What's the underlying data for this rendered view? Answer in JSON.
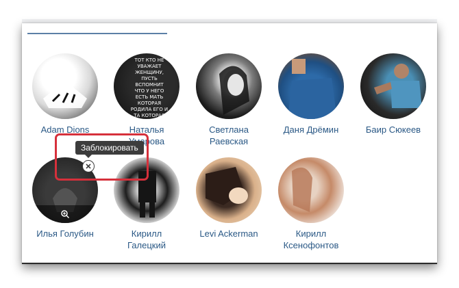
{
  "friends": [
    {
      "name_line1": "Adam Dions",
      "name_line2": ""
    },
    {
      "name_line1": "Наталья",
      "name_line2": "Умарова",
      "avatar_text": "ТОТ КТО НЕ УВАЖАЕТ ЖЕНЩИНУ, ПУСТЬ ВСПОМНИТ ЧТО У НЕГО ЕСТЬ МАТЬ КОТОРАЯ РОДИЛА ЕГО И ТА КОТОРАЯ РОДИТ ЕМУ И ТУ КОТОРАЯ РОДИТСЯ У НЕГО"
    },
    {
      "name_line1": "Светлана",
      "name_line2": "Раевская"
    },
    {
      "name_line1": "Даня Дрёмин",
      "name_line2": ""
    },
    {
      "name_line1": "Баир Сюкеев",
      "name_line2": ""
    },
    {
      "name_line1": "Илья Голубин",
      "name_line2": ""
    },
    {
      "name_line1": "Кирилл",
      "name_line2": "Галецкий"
    },
    {
      "name_line1": "Levi Ackerman",
      "name_line2": ""
    },
    {
      "name_line1": "Кирилл",
      "name_line2": "Ксенофонтов"
    }
  ],
  "tooltip": {
    "block_label": "Заблокировать"
  },
  "icons": {
    "block": "close-icon",
    "zoom": "zoom-icon"
  },
  "colors": {
    "name_link": "#2a5885",
    "highlight": "#d6303b",
    "tooltip_bg": "#3c3c3c"
  }
}
